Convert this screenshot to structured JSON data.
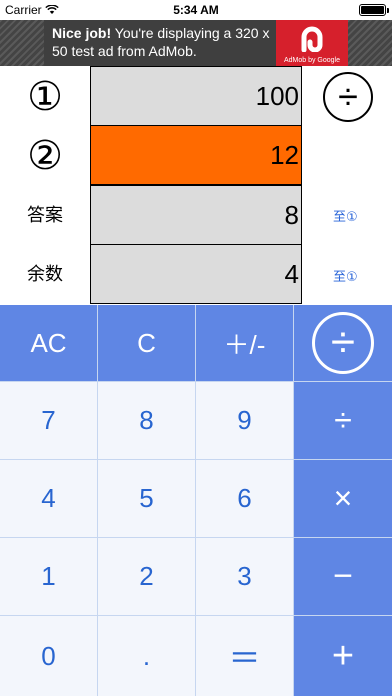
{
  "status_bar": {
    "carrier": "Carrier",
    "time": "5:34 AM"
  },
  "ad": {
    "headline": "Nice job!",
    "body": " You're displaying a 320 x 50 test ad from AdMob.",
    "brand": "AdMob by Google"
  },
  "display": {
    "row1": {
      "label": "①",
      "value": "100"
    },
    "row2": {
      "label": "②",
      "value": "12"
    },
    "answer": {
      "label": "答案",
      "value": "8",
      "link": "至①"
    },
    "remainder": {
      "label": "余数",
      "value": "4",
      "link": "至①"
    },
    "operator": "÷"
  },
  "keypad": {
    "top": [
      "AC",
      "C",
      "＋/-",
      "÷"
    ],
    "rows": [
      [
        "7",
        "8",
        "9",
        "÷"
      ],
      [
        "4",
        "5",
        "6",
        "×"
      ],
      [
        "1",
        "2",
        "3",
        "−"
      ],
      [
        "0",
        ".",
        "＝",
        "+"
      ]
    ]
  },
  "colors": {
    "accent": "#5f86e4",
    "active_field": "#ff6a00",
    "field": "#dcdcdc",
    "key_text": "#2865d0"
  }
}
